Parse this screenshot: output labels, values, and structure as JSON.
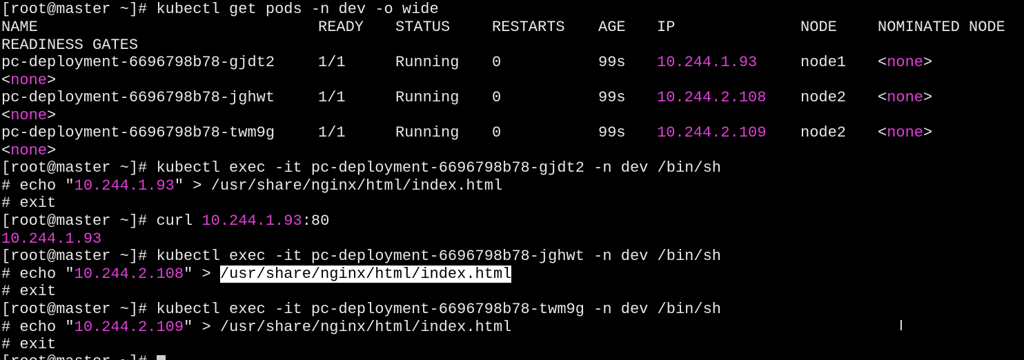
{
  "theme": {
    "background": "#000000",
    "text": "#e8e8e8",
    "ip_color": "#e040d8",
    "selection_bg": "#ffffff",
    "selection_fg": "#000000"
  },
  "prompt": "[root@master ~]# ",
  "shell_prompt": "# ",
  "commands": {
    "get_pods": "kubectl get pods -n dev -o wide",
    "exec1": "kubectl exec -it pc-deployment-6696798b78-gjdt2 -n dev /bin/sh",
    "exec2": "kubectl exec -it pc-deployment-6696798b78-jghwt -n dev /bin/sh",
    "exec3": "kubectl exec -it pc-deployment-6696798b78-twm9g -n dev /bin/sh",
    "curl_cmd": "curl ",
    "curl_ip": "10.244.1.93",
    "curl_port": ":80",
    "echo_prefix": "echo \"",
    "echo_suffix": "\" > ",
    "html_path": "/usr/share/nginx/html/index.html",
    "exit": "exit"
  },
  "table": {
    "headers": {
      "name": "NAME",
      "ready": "READY",
      "status": "STATUS",
      "restarts": "RESTARTS",
      "age": "AGE",
      "ip": "IP",
      "node": "NODE",
      "nominated": "NOMINATED NODE",
      "readiness": "READINESS GATES"
    },
    "rows": [
      {
        "name": "pc-deployment-6696798b78-gjdt2",
        "ready": "1/1",
        "status": "Running",
        "restarts": "0",
        "age": "99s",
        "ip": "10.244.1.93",
        "node": "node1",
        "nominated": "none",
        "readiness": "none"
      },
      {
        "name": "pc-deployment-6696798b78-jghwt",
        "ready": "1/1",
        "status": "Running",
        "restarts": "0",
        "age": "99s",
        "ip": "10.244.2.108",
        "node": "node2",
        "nominated": "none",
        "readiness": "none"
      },
      {
        "name": "pc-deployment-6696798b78-twm9g",
        "ready": "1/1",
        "status": "Running",
        "restarts": "0",
        "age": "99s",
        "ip": "10.244.2.109",
        "node": "node2",
        "nominated": "none",
        "readiness": "none"
      }
    ]
  },
  "outputs": {
    "curl_result": "10.244.1.93"
  },
  "last_prompt": "[root@master ~]# ",
  "icons": {
    "text_cursor": "i-beam-cursor-icon",
    "terminal_cursor": "block-cursor"
  }
}
